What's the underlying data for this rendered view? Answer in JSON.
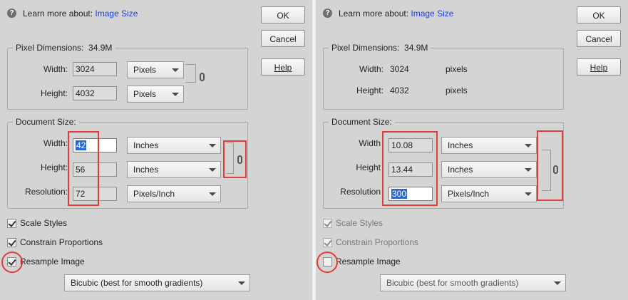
{
  "left": {
    "help_prefix": "Learn more about:",
    "help_link": "Image Size",
    "buttons": {
      "ok": "OK",
      "cancel": "Cancel",
      "help": "Help"
    },
    "pixel_dimensions": {
      "label": "Pixel Dimensions:",
      "value": "34.9M",
      "width_label": "Width:",
      "width_value": "3024",
      "width_unit": "Pixels",
      "height_label": "Height:",
      "height_value": "4032",
      "height_unit": "Pixels"
    },
    "document_size": {
      "label": "Document Size:",
      "width_label": "Width:",
      "width_value": "42",
      "width_unit": "Inches",
      "height_label": "Height:",
      "height_value": "56",
      "height_unit": "Inches",
      "resolution_label": "Resolution:",
      "resolution_value": "72",
      "resolution_unit": "Pixels/Inch"
    },
    "checkboxes": {
      "scale_styles": {
        "label": "Scale Styles",
        "checked": true
      },
      "constrain_proportions": {
        "label": "Constrain Proportions",
        "checked": true
      },
      "resample_image": {
        "label": "Resample Image",
        "checked": true
      }
    },
    "resample_method": "Bicubic (best for smooth gradients)"
  },
  "right": {
    "help_prefix": "Learn more about:",
    "help_link": "Image Size",
    "buttons": {
      "ok": "OK",
      "cancel": "Cancel",
      "help": "Help"
    },
    "pixel_dimensions": {
      "label": "Pixel Dimensions:",
      "value": "34.9M",
      "width_label": "Width:",
      "width_value": "3024",
      "width_unit": "pixels",
      "height_label": "Height:",
      "height_value": "4032",
      "height_unit": "pixels"
    },
    "document_size": {
      "label": "Document Size:",
      "width_label": "Width",
      "width_value": "10.08",
      "width_unit": "Inches",
      "height_label": "Height",
      "height_value": "13.44",
      "height_unit": "Inches",
      "resolution_label": "Resolution",
      "resolution_value": "300",
      "resolution_unit": "Pixels/Inch"
    },
    "checkboxes": {
      "scale_styles": {
        "label": "Scale Styles",
        "checked": true
      },
      "constrain_proportions": {
        "label": "Constrain Proportions",
        "checked": true
      },
      "resample_image": {
        "label": "Resample Image",
        "checked": false
      }
    },
    "resample_method": "Bicubic (best for smooth gradients)"
  },
  "colors": {
    "highlight": "#e33a3a",
    "link": "#1c3ee0",
    "selection": "#2f66c9"
  },
  "icons": [
    "help-icon",
    "chain-link-icon",
    "dropdown-caret-icon",
    "checkbox-check-icon"
  ]
}
